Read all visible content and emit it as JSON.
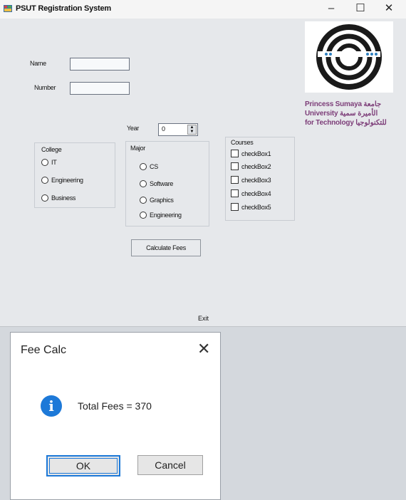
{
  "window": {
    "title": "PSUT Registration System",
    "controls": {
      "minimize": "–",
      "maximize": "☐",
      "close": "✕"
    }
  },
  "form": {
    "name_label": "Name",
    "number_label": "Number",
    "name_value": "",
    "number_value": "",
    "year_label": "Year",
    "year_value": "0",
    "college": {
      "label": "College",
      "options": [
        "IT",
        "Engineering",
        "Business"
      ]
    },
    "major": {
      "label": "Major",
      "options": [
        "CS",
        "Software",
        "Graphics",
        "Engineering"
      ]
    },
    "courses": {
      "label": "Courses",
      "options": [
        "checkBox1",
        "checkBox2",
        "checkBox3",
        "checkBox4",
        "checkBox5"
      ]
    },
    "calculate_label": "Calculate Fees",
    "exit_label": "Exit"
  },
  "logo": {
    "line1": "Princess Sumaya جامعة",
    "line2": "University الأميرة سمية",
    "line3": "for Technology للتكنولوجيا",
    "color": "#7d3e79"
  },
  "dialog": {
    "title": "Fee Calc",
    "close": "✕",
    "icon": "info-icon",
    "message": "Total Fees = 370",
    "ok_label": "OK",
    "cancel_label": "Cancel",
    "accent": "#1d79d8"
  }
}
